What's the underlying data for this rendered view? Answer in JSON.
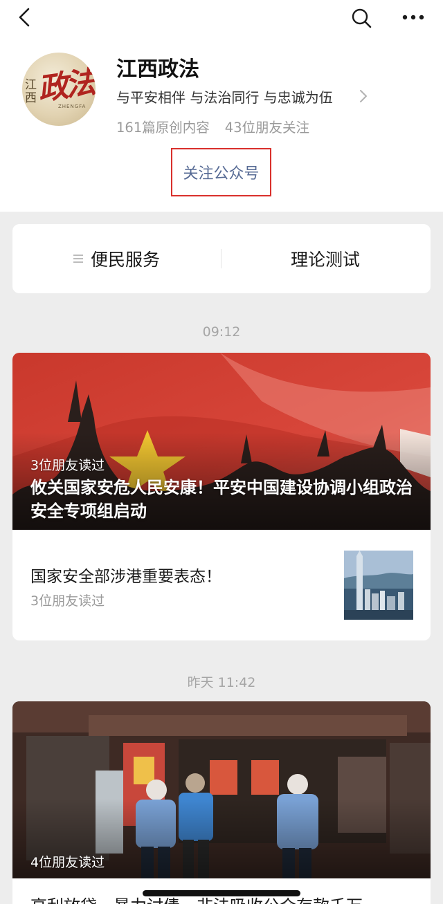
{
  "nav": {
    "back_icon": "chevron-left-icon",
    "search_icon": "search-icon",
    "more_icon": "more-icon"
  },
  "account": {
    "name": "江西政法",
    "slogan": "与平安相伴 与法治同行 与忠诚为伍",
    "original_count": "161篇原创内容",
    "friends_follow": "43位朋友关注",
    "follow_button": "关注公众号",
    "avatar": {
      "side_text": "江西",
      "main_text": "政法",
      "small_text": "ZHENGFA"
    }
  },
  "menu": [
    {
      "label": "便民服务",
      "icon": "menu-lines-icon"
    },
    {
      "label": "理论测试"
    }
  ],
  "feed": [
    {
      "time": "09:12",
      "main": {
        "reads": "3位朋友读过",
        "title": "攸关国家安危人民安康！平安中国建设协调小组政治安全专项组启动"
      },
      "sub": {
        "title": "国家安全部涉港重要表态！",
        "reads": "3位朋友读过"
      }
    },
    {
      "time": "昨天 11:42",
      "main": {
        "reads": "4位朋友读过",
        "title": "高利放贷、暴力讨债、非法吸收公众存款千万"
      }
    }
  ],
  "colors": {
    "link_blue": "#576b95",
    "highlight_red": "#d9302c",
    "background": "#ededed"
  }
}
